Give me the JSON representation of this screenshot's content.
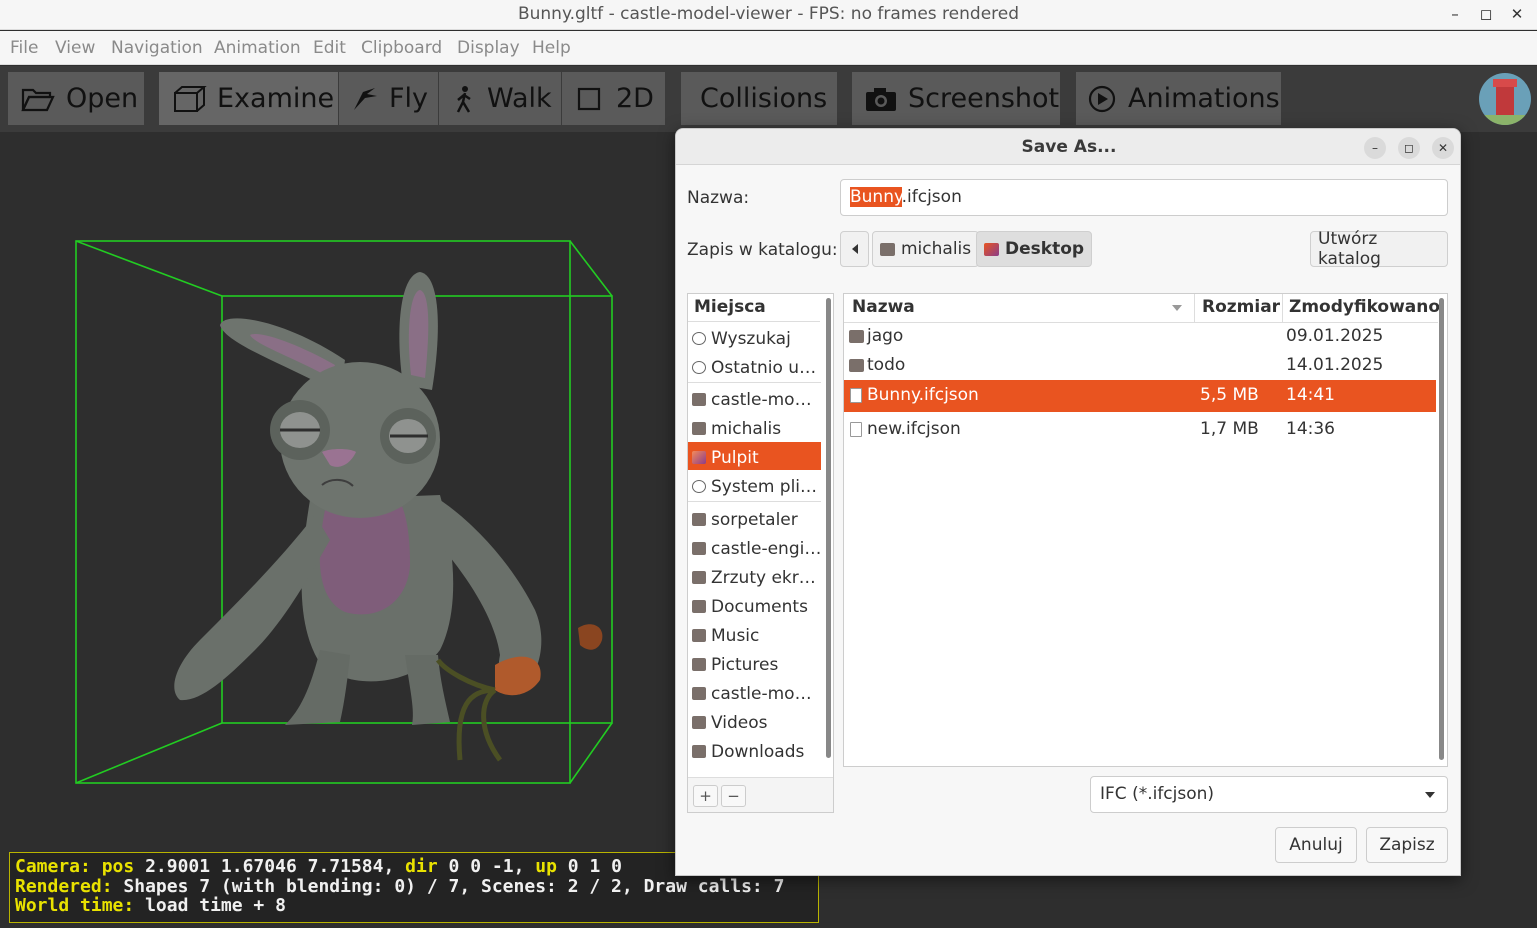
{
  "window": {
    "title": "Bunny.gltf - castle-model-viewer - FPS: no frames rendered",
    "controls": [
      "–",
      "◻",
      "✕"
    ]
  },
  "menu": [
    "File",
    "View",
    "Navigation",
    "Animation",
    "Edit",
    "Clipboard",
    "Display",
    "Help"
  ],
  "toolbar": {
    "open": "Open",
    "examine": "Examine",
    "fly": "Fly",
    "walk": "Walk",
    "mode_2d": "2D",
    "collisions": "Collisions",
    "screenshot": "Screenshot",
    "animations": "Animations"
  },
  "hud": {
    "camera_key": "Camera:",
    "camera_pos_key": "pos",
    "camera_pos": "2.9001 1.67046 7.71584",
    "camera_dir_key": "dir",
    "camera_dir": "0 0 -1",
    "camera_up_key": "up",
    "camera_up": "0 1 0",
    "rendered_key": "Rendered:",
    "rendered_val": "Shapes 7 (with blending: 0) / 7, Scenes: 2 / 2, Draw calls: 7",
    "world_key": "World time:",
    "world_val": "load time + 8"
  },
  "dialog": {
    "title": "Save As...",
    "name_label": "Nazwa:",
    "name_selected": "Bunny",
    "name_rest": ".ifcjson",
    "save_in_label": "Zapis w katalogu:",
    "path": [
      "michalis",
      "Desktop"
    ],
    "create_folder": "Utwórz katalog",
    "places_header": "Miejsca",
    "places": [
      {
        "label": "Wyszukaj",
        "icon": "search-icon"
      },
      {
        "label": "Ostatnio u…",
        "icon": "recent-icon"
      },
      {
        "label": "castle-mo…",
        "icon": "folder-icon"
      },
      {
        "label": "michalis",
        "icon": "home-icon"
      },
      {
        "label": "Pulpit",
        "icon": "desktop-icon"
      },
      {
        "label": "System pli…",
        "icon": "drive-icon"
      },
      {
        "label": "sorpetaler",
        "icon": "folder-icon"
      },
      {
        "label": "castle-engi…",
        "icon": "folder-icon"
      },
      {
        "label": "Zrzuty ekr…",
        "icon": "folder-icon"
      },
      {
        "label": "Documents",
        "icon": "folder-icon"
      },
      {
        "label": "Music",
        "icon": "music-folder-icon"
      },
      {
        "label": "Pictures",
        "icon": "pictures-folder-icon"
      },
      {
        "label": "castle-mo…",
        "icon": "folder-icon"
      },
      {
        "label": "Videos",
        "icon": "videos-folder-icon"
      },
      {
        "label": "Downloads",
        "icon": "downloads-folder-icon"
      }
    ],
    "columns": {
      "name": "Nazwa",
      "size": "Rozmiar",
      "modified": "Zmodyfikowano"
    },
    "files": [
      {
        "name": "jago",
        "size": "",
        "modified": "09.01.2025",
        "type": "folder"
      },
      {
        "name": "todo",
        "size": "",
        "modified": "14.01.2025",
        "type": "folder"
      },
      {
        "name": "Bunny.ifcjson",
        "size": "5,5 MB",
        "modified": "14:41",
        "type": "file"
      },
      {
        "name": "new.ifcjson",
        "size": "1,7 MB",
        "modified": "14:36",
        "type": "file"
      }
    ],
    "filter": "IFC (*.ifcjson)",
    "cancel": "Anuluj",
    "save": "Zapisz",
    "add": "+",
    "remove": "−"
  },
  "colors": {
    "accent": "#e95420",
    "bbox": "#22cc22",
    "hud_key": "#e9e200"
  }
}
